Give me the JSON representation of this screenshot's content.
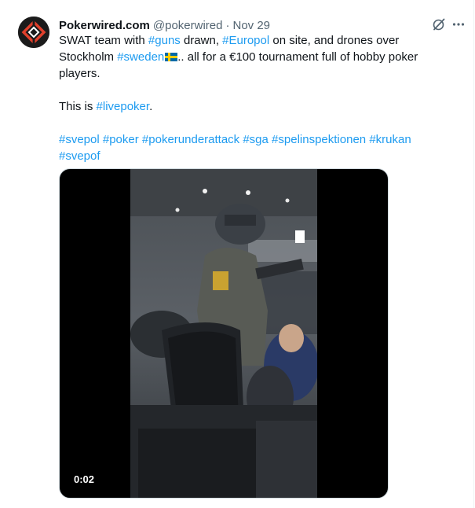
{
  "tweet": {
    "display_name": "Pokerwired.com",
    "handle": "@pokerwired",
    "separator": "·",
    "date": "Nov 29",
    "text": {
      "line1": {
        "a": "SWAT team with ",
        "tag1": "#guns",
        "b": " drawn, ",
        "tag2": "#Europol",
        "c": " on site, and drones over"
      },
      "line2": {
        "a": "Stockholm ",
        "tag1": "#sweden",
        "flag": "sweden-flag-emoji",
        "b": ".. all for a €100 tournament full of hobby poker"
      },
      "line3": "players.",
      "line4": {
        "a": "This is ",
        "tag1": "#livepoker",
        "b": "."
      },
      "hashtags_line1": [
        "#svepol",
        "#poker",
        "#pokerunderattack",
        "#sga",
        "#spelinspektionen",
        "#krukan"
      ],
      "hashtags_line2": [
        "#svepof"
      ]
    },
    "media": {
      "type": "video",
      "duration": "0:02"
    }
  },
  "icons": {
    "grok": "grok-icon",
    "more": "more-icon",
    "avatar": "pokerwired-logo"
  },
  "colors": {
    "link": "#1d9bf0",
    "secondary_text": "#536471",
    "primary_text": "#0f1419",
    "logo_red": "#e0402c"
  }
}
